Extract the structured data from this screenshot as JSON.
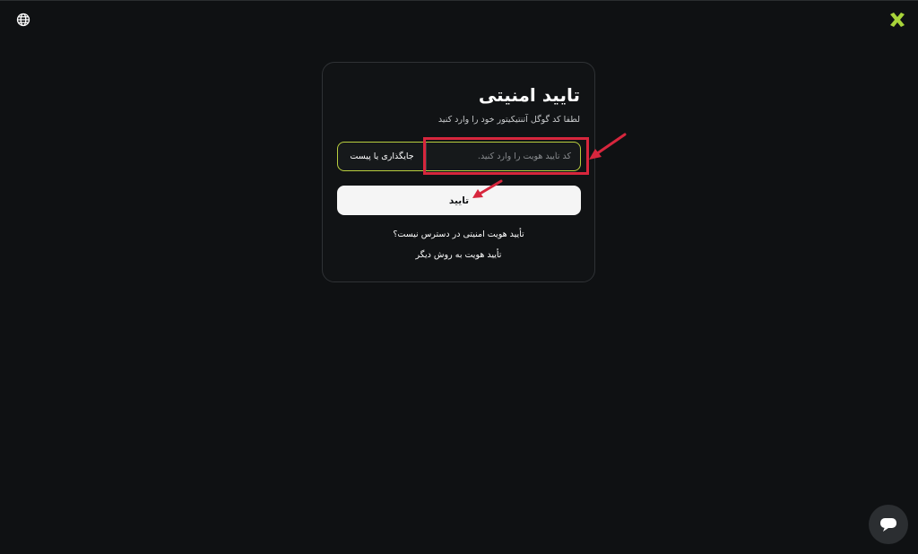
{
  "card": {
    "title": "تایید امنیتی",
    "subtitle": "لطفا کد گوگل آتنتیکیتور خود را وارد کنید",
    "code_input_placeholder": "کد تأیید هویت را وارد کنید.",
    "code_input_value": "",
    "paste_label": "جایگذاری یا پیست",
    "confirm_label": "تایید",
    "unavailable_link": "تأیید هویت امنیتی در دسترس نیست؟",
    "other_method_link": "تأیید هویت به روش دیگر"
  },
  "icons": {
    "top_left": "globe-icon",
    "top_right": "logo-x-icon",
    "bottom_right": "chat-icon"
  },
  "colors": {
    "background": "#0f1113",
    "accent": "#b9cf3e",
    "annotation": "#d7263d",
    "button": "#f5f5f5"
  }
}
